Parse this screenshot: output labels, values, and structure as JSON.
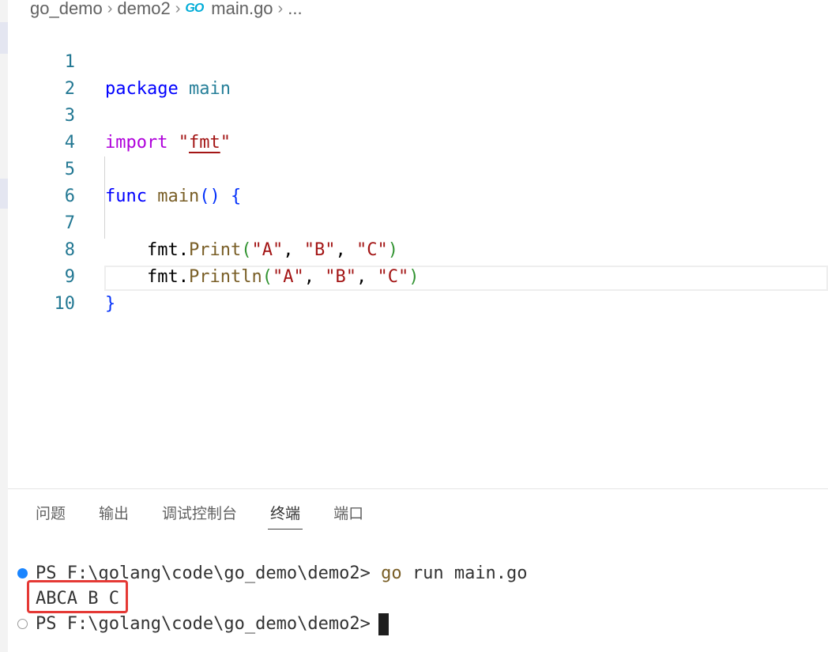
{
  "breadcrumb": {
    "items": [
      "go_demo",
      "demo2",
      "main.go",
      "..."
    ],
    "file_icon_text": "GO"
  },
  "editor": {
    "line_numbers": [
      "1",
      "2",
      "3",
      "4",
      "5",
      "6",
      "7",
      "8",
      "9",
      "10"
    ],
    "code": {
      "l1_kw": "package",
      "l1_name": "main",
      "l3_kw": "import",
      "l3_q1": "\"",
      "l3_str": "fmt",
      "l3_q2": "\"",
      "l5_kw": "func",
      "l5_fn": "main",
      "l5_paren": "()",
      "l5_brace": "{",
      "l7_pkg": "fmt",
      "l7_dot": ".",
      "l7_fn": "Print",
      "l7_open": "(",
      "l7_a": "\"A\"",
      "l7_c1": ", ",
      "l7_b": "\"B\"",
      "l7_c2": ", ",
      "l7_c": "\"C\"",
      "l7_close": ")",
      "l8_pkg": "fmt",
      "l8_dot": ".",
      "l8_fn": "Println",
      "l8_open": "(",
      "l8_a": "\"A\"",
      "l8_c1": ", ",
      "l8_b": "\"B\"",
      "l8_c2": ", ",
      "l8_c": "\"C\"",
      "l8_close": ")",
      "l9_brace": "}"
    }
  },
  "panel": {
    "tabs": [
      "问题",
      "输出",
      "调试控制台",
      "终端",
      "端口"
    ],
    "active_tab": "终端"
  },
  "terminal": {
    "prompt": "PS F:\\golang\\code\\go_demo\\demo2>",
    "command": "go",
    "args": "run main.go",
    "output": "ABCA B C",
    "prompt2": "PS F:\\golang\\code\\go_demo\\demo2>"
  },
  "colors": {
    "keyword": "#0000ff",
    "import_keyword": "#af00db",
    "function": "#795e26",
    "string": "#a31515",
    "line_number": "#237893",
    "highlight_box": "#e53935",
    "terminal_dot": "#1a85ff"
  }
}
